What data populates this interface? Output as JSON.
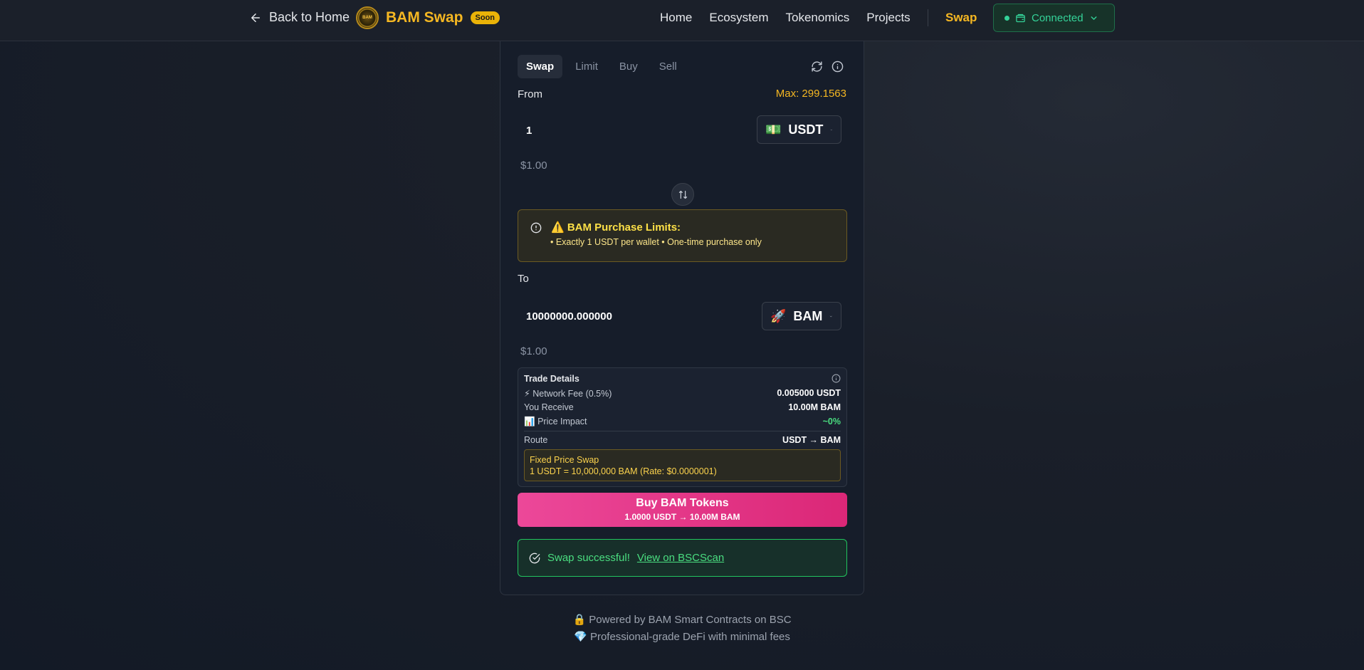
{
  "header": {
    "back_label": "Back to Home",
    "brand_name": "BAM Swap",
    "brand_badge": "Soon",
    "logo_text": "BAM",
    "nav": [
      "Home",
      "Ecosystem",
      "Tokenomics",
      "Projects"
    ],
    "active_nav": "Swap",
    "wallet_status": "Connected"
  },
  "tabs": [
    "Swap",
    "Limit",
    "Buy",
    "Sell"
  ],
  "from": {
    "label": "From",
    "max": "Max: 299.1563",
    "amount": "1",
    "token": "USDT",
    "token_icon": "💵",
    "usd_value": "$1.00"
  },
  "warning": {
    "title": "⚠️ BAM Purchase Limits:",
    "text": "• Exactly 1 USDT per wallet • One-time purchase only"
  },
  "to": {
    "label": "To",
    "amount": "10000000.000000",
    "token": "BAM",
    "token_icon": "🚀",
    "usd_value": "$1.00"
  },
  "trade_details": {
    "title": "Trade Details",
    "network_fee_label": "Network Fee (0.5%)",
    "network_fee_value": "0.005000 USDT",
    "receive_label": "You Receive",
    "receive_value": "10.00M BAM",
    "impact_label": "Price Impact",
    "impact_value": "~0%",
    "route_label": "Route",
    "route_value": "USDT → BAM",
    "fixed_title": "Fixed Price Swap",
    "fixed_rate": "1 USDT = 10,000,000 BAM (Rate: $0.0000001)"
  },
  "buy_button": {
    "label": "Buy BAM Tokens",
    "sub": "1.0000 USDT → 10.00M BAM"
  },
  "success": {
    "text": "Swap successful!",
    "link": "View on BSCScan"
  },
  "footer": {
    "line1": "🔒 Powered by BAM Smart Contracts on BSC",
    "line2": "💎 Professional-grade DeFi with minimal fees"
  },
  "colors": {
    "accent_gold": "#f5b722",
    "success_green": "#4ade80",
    "buy_pink": "#ec4899"
  }
}
